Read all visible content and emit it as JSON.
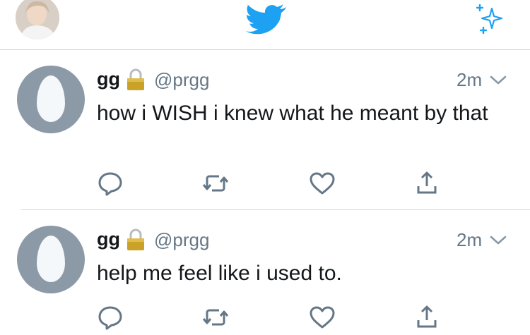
{
  "header": {
    "profile_icon": "profile-photo-icon",
    "logo_icon": "twitter-bird-icon",
    "logo_color": "#1da1f2",
    "compose_icon": "sparkle-icon"
  },
  "tweets": [
    {
      "name": "gg",
      "handle": "@prgg",
      "time": "2m",
      "text": "how i WISH i knew what he meant by that",
      "protected_icon": "lock-icon",
      "actions": [
        "reply-icon",
        "retweet-icon",
        "like-icon",
        "share-icon"
      ]
    },
    {
      "name": "gg",
      "handle": "@prgg",
      "time": "2m",
      "text": "help me feel like i used to.",
      "protected_icon": "lock-icon",
      "actions": [
        "reply-icon",
        "retweet-icon",
        "like-icon",
        "share-icon"
      ]
    }
  ],
  "colors": {
    "icon_gray": "#657786",
    "divider": "#cfd6db",
    "lock_gold": "#c9a227"
  }
}
